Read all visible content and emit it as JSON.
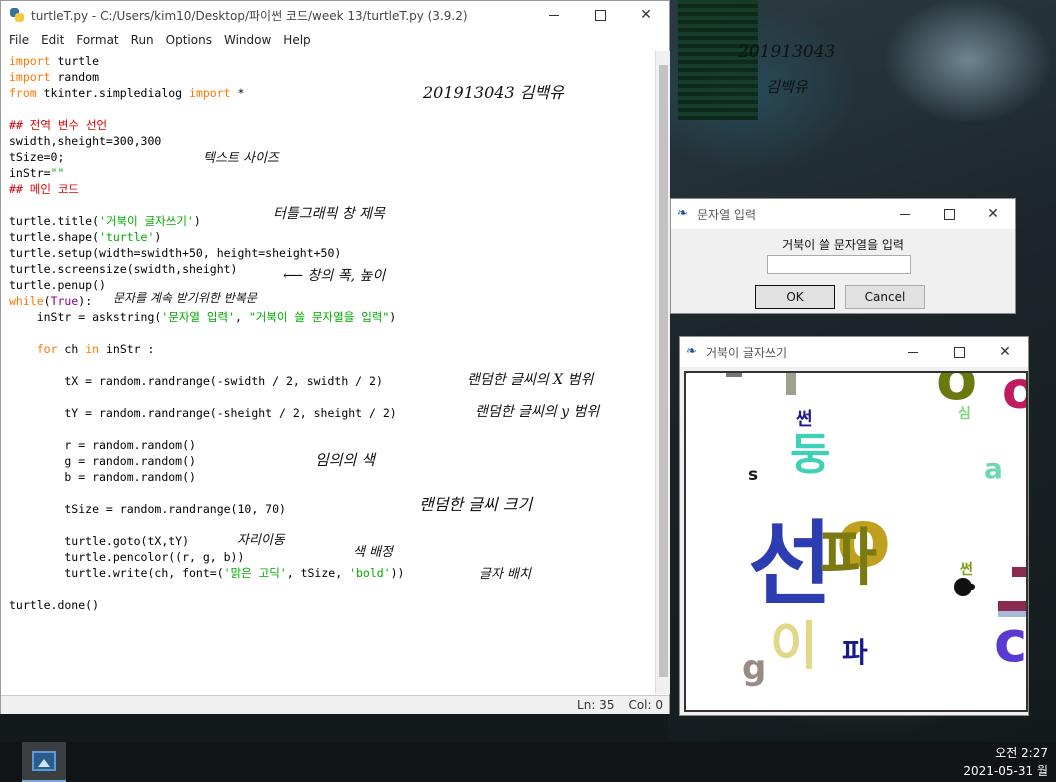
{
  "idle": {
    "title": "turtleT.py - C:/Users/kim10/Desktop/파이썬 코드/week 13/turtleT.py (3.9.2)",
    "menu": [
      "File",
      "Edit",
      "Format",
      "Run",
      "Options",
      "Window",
      "Help"
    ],
    "code_lines": [
      [
        [
          "kw",
          "import"
        ],
        [
          "n",
          " turtle"
        ]
      ],
      [
        [
          "kw",
          "import"
        ],
        [
          "n",
          " random"
        ]
      ],
      [
        [
          "kw",
          "from"
        ],
        [
          "n",
          " tkinter.simpledialog "
        ],
        [
          "kw",
          "import"
        ],
        [
          "n",
          " *"
        ]
      ],
      [
        [
          "n",
          ""
        ]
      ],
      [
        [
          "cm",
          "## 전역 변수 선언"
        ]
      ],
      [
        [
          "n",
          "swidth,sheight=300,300"
        ]
      ],
      [
        [
          "n",
          "tSize=0;"
        ]
      ],
      [
        [
          "n",
          "inStr="
        ],
        [
          "str",
          "\"\""
        ]
      ],
      [
        [
          "cm",
          "## 메인 코드"
        ]
      ],
      [
        [
          "n",
          ""
        ]
      ],
      [
        [
          "n",
          "turtle.title("
        ],
        [
          "str",
          "'거북이 글자쓰기'"
        ],
        [
          "n",
          ")"
        ]
      ],
      [
        [
          "n",
          "turtle.shape("
        ],
        [
          "str",
          "'turtle'"
        ],
        [
          "n",
          ")"
        ]
      ],
      [
        [
          "n",
          "turtle.setup(width=swidth+50, height=sheight+50)"
        ]
      ],
      [
        [
          "n",
          "turtle.screensize(swidth,sheight)"
        ]
      ],
      [
        [
          "n",
          "turtle.penup()"
        ]
      ],
      [
        [
          "kw",
          "while"
        ],
        [
          "n",
          "("
        ],
        [
          "bi",
          "True"
        ],
        [
          "n",
          "):"
        ]
      ],
      [
        [
          "n",
          "    inStr = askstring("
        ],
        [
          "str",
          "'문자열 입력'"
        ],
        [
          "n",
          ", "
        ],
        [
          "str",
          "\"거북이 쓸 문자열을 입력\""
        ],
        [
          "n",
          ")"
        ]
      ],
      [
        [
          "n",
          ""
        ]
      ],
      [
        [
          "n",
          "    "
        ],
        [
          "kw",
          "for"
        ],
        [
          "n",
          " ch "
        ],
        [
          "kw",
          "in"
        ],
        [
          "n",
          " inStr :"
        ]
      ],
      [
        [
          "n",
          ""
        ]
      ],
      [
        [
          "n",
          "        tX = random.randrange(-swidth / 2, swidth / 2)"
        ]
      ],
      [
        [
          "n",
          ""
        ]
      ],
      [
        [
          "n",
          "        tY = random.randrange(-sheight / 2, sheight / 2)"
        ]
      ],
      [
        [
          "n",
          ""
        ]
      ],
      [
        [
          "n",
          "        r = random.random()"
        ]
      ],
      [
        [
          "n",
          "        g = random.random()"
        ]
      ],
      [
        [
          "n",
          "        b = random.random()"
        ]
      ],
      [
        [
          "n",
          ""
        ]
      ],
      [
        [
          "n",
          "        tSize = random.randrange(10, 70)"
        ]
      ],
      [
        [
          "n",
          ""
        ]
      ],
      [
        [
          "n",
          "        turtle.goto(tX,tY)"
        ]
      ],
      [
        [
          "n",
          "        turtle.pencolor((r, g, b))"
        ]
      ],
      [
        [
          "n",
          "        turtle.write(ch, font=("
        ],
        [
          "str",
          "'맑은 고딕'"
        ],
        [
          "n",
          ", tSize, "
        ],
        [
          "str",
          "'bold'"
        ],
        [
          "n",
          "))"
        ]
      ],
      [
        [
          "n",
          ""
        ]
      ],
      [
        [
          "n",
          "turtle.done()"
        ]
      ]
    ],
    "status": {
      "line": "Ln: 35",
      "col": "Col: 0"
    }
  },
  "annotations": {
    "student_id": "201913043 김백유",
    "text_size": "텍스트 사이즈",
    "window_title": "터틀그래픽 창 제목",
    "window_size": "창의 폭, 높이",
    "loop": "문자를 계속 받기위한 반복문",
    "random_x": "랜덤한 글씨의 X 범위",
    "random_y": "랜덤한 글씨의 y 범위",
    "random_color": "임의의 색",
    "random_size": "랜덤한 글씨 크기",
    "move": "자리이동",
    "color": "색 배정",
    "write": "글자 배치",
    "wallpaper_id": "201913043",
    "wallpaper_name": "김백유"
  },
  "dialog": {
    "title": "문자열 입력",
    "prompt": "거북이 쓸 문자열을 입력",
    "input_value": "",
    "ok": "OK",
    "cancel": "Cancel"
  },
  "turtle_window": {
    "title": "거북이 글자쓰기",
    "chars": [
      {
        "text": "썬",
        "color": "#1a1a8c"
      },
      {
        "text": "심",
        "color": "#7fd47f"
      },
      {
        "text": "둥",
        "color": "#3fd1b8"
      },
      {
        "text": "s",
        "color": "#1a1a1a"
      },
      {
        "text": "a",
        "color": "#6ed6b4"
      },
      {
        "text": "선",
        "color": "#2b3db0"
      },
      {
        "text": "o",
        "color": "#c0a020"
      },
      {
        "text": "파",
        "color": "#7a7a10"
      },
      {
        "text": "썬",
        "color": "#7aa010"
      },
      {
        "text": "이",
        "color": "#e0d88a"
      },
      {
        "text": "파",
        "color": "#1a1a8c"
      },
      {
        "text": "g",
        "color": "#9a8a84"
      },
      {
        "text": "c",
        "color": "#5a3ad0"
      },
      {
        "text": "o",
        "color": "#6a7a10"
      },
      {
        "text": "o",
        "color": "#c01a60"
      }
    ]
  },
  "taskbar": {
    "time": "오전 2:27",
    "date": "2021-05-31 월"
  }
}
